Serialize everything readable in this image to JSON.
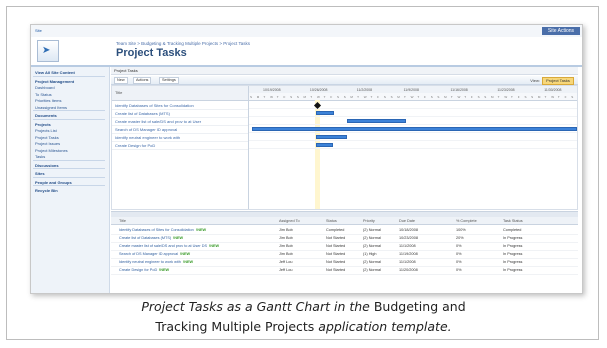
{
  "window": {
    "welcome": "Site",
    "top_link": "",
    "site_actions": "Site Actions"
  },
  "header": {
    "breadcrumb": "Team Site > Budgeting & Tracking Multiple Projects > Project Tasks",
    "page_title": "Project Tasks"
  },
  "leftnav": {
    "items": [
      {
        "label": "View All Site Content",
        "kind": "head"
      },
      {
        "label": "Project Management",
        "kind": "head"
      },
      {
        "label": "Dashboard",
        "kind": "item"
      },
      {
        "label": "To Status",
        "kind": "item"
      },
      {
        "label": "Priorities Items",
        "kind": "item"
      },
      {
        "label": "Unassigned Items",
        "kind": "item"
      },
      {
        "label": "Documents",
        "kind": "head"
      },
      {
        "label": "Projects",
        "kind": "head"
      },
      {
        "label": "Projects List",
        "kind": "item"
      },
      {
        "label": "Project Tasks",
        "kind": "item"
      },
      {
        "label": "Project Issues",
        "kind": "item"
      },
      {
        "label": "Project Milestones",
        "kind": "item"
      },
      {
        "label": "Tasks",
        "kind": "item"
      },
      {
        "label": "Discussions",
        "kind": "head"
      },
      {
        "label": "Sites",
        "kind": "head"
      },
      {
        "label": "People and Groups",
        "kind": "head"
      },
      {
        "label": "Recycle Bin",
        "kind": "head"
      }
    ]
  },
  "toolbar": {
    "items": [
      "Project Tasks"
    ]
  },
  "actionbar": {
    "buttons": [
      "New",
      "Actions",
      "Settings"
    ],
    "view_label": "View:",
    "view_value": "Project Tasks"
  },
  "gantt": {
    "task_header": "Title",
    "tasks": [
      "Identify Databases of Sites for Consolidation",
      "Create list of Databases (MTS)",
      "Create master list of sale/DS and prov to at User",
      "Search of DS Manager ID approval",
      "Identify neutral engineer to work with",
      "Create Design for PoD"
    ],
    "dates": [
      "10/19/2008",
      "10/26/2008",
      "11/2/2008",
      "11/9/2008",
      "11/16/2008",
      "11/23/2008",
      "11/30/2008"
    ],
    "day_letters": [
      "S",
      "M",
      "T",
      "W",
      "T",
      "F",
      "S"
    ],
    "bars": [
      {
        "type": "milestone",
        "start": 0.205
      },
      {
        "type": "bar",
        "start": 0.205,
        "end": 0.26
      },
      {
        "type": "bar",
        "start": 0.3,
        "end": 0.48
      },
      {
        "type": "bar",
        "start": 0.01,
        "end": 1.0
      },
      {
        "type": "bar",
        "start": 0.205,
        "end": 0.3
      },
      {
        "type": "bar",
        "start": 0.205,
        "end": 0.255
      }
    ],
    "today_position": 0.205
  },
  "list": {
    "headers": [
      "Title",
      "Assigned To",
      "Status",
      "Priority",
      "Due Date",
      "% Complete",
      "Task Status"
    ],
    "rows": [
      {
        "title": "Identify Databases of Sites for Consolidation",
        "new": "!NEW",
        "assigned": "Jim Bob",
        "status": "Completed",
        "priority": "(2) Normal",
        "due": "10/18/2008",
        "pct": "100%",
        "task_status": "Completed"
      },
      {
        "title": "Create list of Databases (MTS)",
        "new": "!NEW",
        "assigned": "Jim Bob",
        "status": "Not Started",
        "priority": "(2) Normal",
        "due": "10/23/2008",
        "pct": "20%",
        "task_status": "In Progress"
      },
      {
        "title": "Create master list of sale/DS and prov to at User DS",
        "new": "!NEW",
        "assigned": "Jim Bob",
        "status": "Not Started",
        "priority": "(2) Normal",
        "due": "11/1/2008",
        "pct": "0%",
        "task_status": "In Progress"
      },
      {
        "title": "Search of DS Manager ID approval",
        "new": "!NEW",
        "assigned": "Jim Bob",
        "status": "Not Started",
        "priority": "(1) High",
        "due": "11/19/2008",
        "pct": "0%",
        "task_status": "In Progress"
      },
      {
        "title": "Identify neutral engineer to work with",
        "new": "!NEW",
        "assigned": "Jeff Lou",
        "status": "Not Started",
        "priority": "(2) Normal",
        "due": "11/1/2008",
        "pct": "0%",
        "task_status": "In Progress"
      },
      {
        "title": "Create Design for PoD",
        "new": "!NEW",
        "assigned": "Jeff Lou",
        "status": "Not Started",
        "priority": "(2) Normal",
        "due": "11/20/2008",
        "pct": "0%",
        "task_status": "In Progress"
      }
    ]
  },
  "caption": {
    "line1_italic_a": "Project Tasks as a Gantt Chart in the ",
    "line1_plain": "Budgeting and",
    "line2_plain": "Tracking Multiple Projects ",
    "line2_italic": "application template."
  }
}
